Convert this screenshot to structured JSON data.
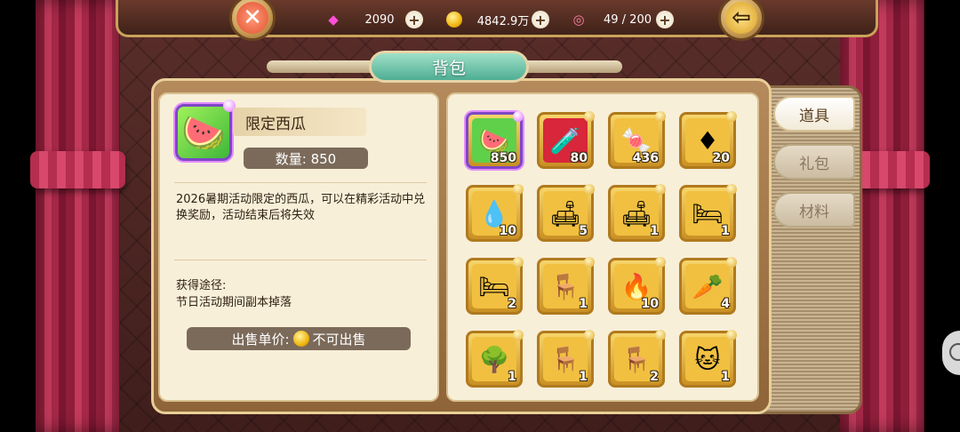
{
  "topbar": {
    "gems": "2090",
    "gold": "4842.9万",
    "stamina": "49 / 200"
  },
  "title": "背包",
  "tabs": [
    "道具",
    "礼包",
    "材料"
  ],
  "detail": {
    "name": "限定西瓜",
    "quantity": "数量: 850",
    "description": "2026暑期活动限定的西瓜，可以在精彩活动中兑换奖励，活动结束后将失效",
    "source_heading": "获得途径:",
    "source_text": "节日活动期间副本掉落",
    "sell_label": "出售单价:",
    "sell_value": "不可出售"
  },
  "items": [
    {
      "icon": "watermelon-icon",
      "glyph": "🍉",
      "count": "850",
      "bg": "#5fd04a"
    },
    {
      "icon": "potion-bottle-icon",
      "glyph": "🧪",
      "count": "80",
      "bg": "#d8263a"
    },
    {
      "icon": "candy-icon",
      "glyph": "🍬",
      "count": "436",
      "bg": "#f1c040"
    },
    {
      "icon": "fire-gem-icon",
      "glyph": "♦",
      "count": "20",
      "bg": "#f1c040"
    },
    {
      "icon": "water-drop-icon",
      "glyph": "💧",
      "count": "10",
      "bg": "#f1c040"
    },
    {
      "icon": "pink-sofa-icon",
      "glyph": "🛋",
      "count": "5",
      "bg": "#f1c040"
    },
    {
      "icon": "blue-sofa-icon",
      "glyph": "🛋",
      "count": "1",
      "bg": "#f1c040"
    },
    {
      "icon": "blue-bed-icon",
      "glyph": "🛏",
      "count": "1",
      "bg": "#f1c040"
    },
    {
      "icon": "pink-bed-icon",
      "glyph": "🛏",
      "count": "2",
      "bg": "#f1c040"
    },
    {
      "icon": "pink-desk-icon",
      "glyph": "🪑",
      "count": "1",
      "bg": "#f1c040"
    },
    {
      "icon": "flame-gem-icon",
      "glyph": "🔥",
      "count": "10",
      "bg": "#f1c040"
    },
    {
      "icon": "carrot-candy-icon",
      "glyph": "🥕",
      "count": "4",
      "bg": "#f1c040"
    },
    {
      "icon": "bonsai-tree-icon",
      "glyph": "🌳",
      "count": "1",
      "bg": "#f1c040"
    },
    {
      "icon": "pink-armchair-icon",
      "glyph": "🪑",
      "count": "1",
      "bg": "#f1c040"
    },
    {
      "icon": "black-chair-icon",
      "glyph": "🪑",
      "count": "2",
      "bg": "#f1c040"
    },
    {
      "icon": "cat-card-icon",
      "glyph": "🐱",
      "count": "1",
      "bg": "#f1c040"
    }
  ],
  "colors": {
    "gold_frame": "#c99024",
    "selected_border": "#7e47c6",
    "panel": "#f8efd9"
  }
}
